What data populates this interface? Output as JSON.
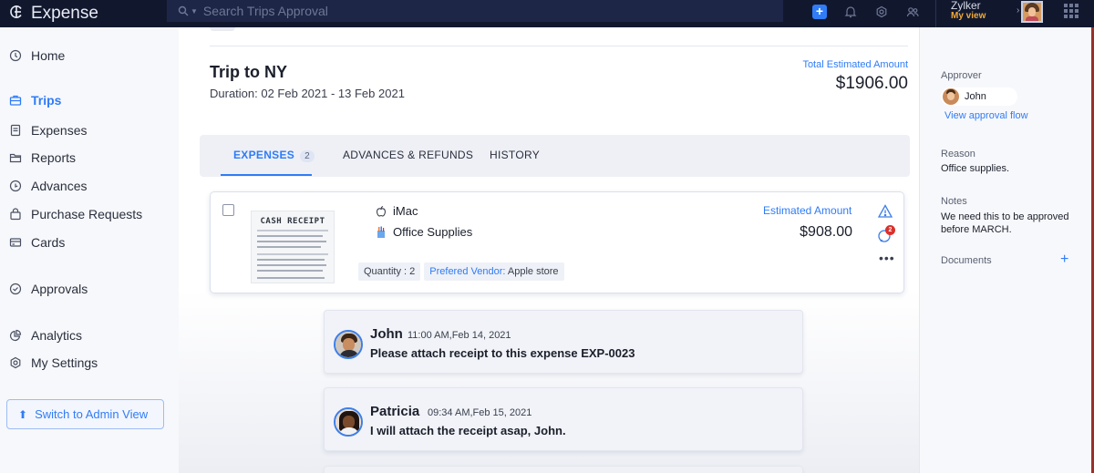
{
  "app": {
    "name": "Expense"
  },
  "search": {
    "placeholder": "Search Trips Approval"
  },
  "org": {
    "name": "Zylker",
    "view_label": "My view"
  },
  "sidebar": {
    "items": [
      {
        "label": "Home",
        "icon": "home-icon"
      },
      {
        "label": "Trips",
        "icon": "briefcase-icon",
        "active": true
      },
      {
        "label": "Expenses",
        "icon": "receipt-icon"
      },
      {
        "label": "Reports",
        "icon": "folder-icon"
      },
      {
        "label": "Advances",
        "icon": "advance-icon"
      },
      {
        "label": "Purchase Requests",
        "icon": "bag-icon"
      },
      {
        "label": "Cards",
        "icon": "card-icon"
      },
      {
        "label": "Approvals",
        "icon": "check-circle-icon"
      },
      {
        "label": "Analytics",
        "icon": "pie-chart-icon"
      },
      {
        "label": "My Settings",
        "icon": "gear-icon"
      }
    ],
    "switch_label": "Switch to Admin View"
  },
  "trip": {
    "title": "Trip to NY",
    "duration": "Duration: 02 Feb 2021 - 13 Feb 2021",
    "total_label": "Total Estimated Amount",
    "total_value": "$1906.00"
  },
  "tabs": [
    {
      "label": "EXPENSES",
      "count": "2",
      "active": true
    },
    {
      "label": "ADVANCES & REFUNDS"
    },
    {
      "label": "HISTORY"
    }
  ],
  "expense": {
    "receipt_title": "CASH RECEIPT",
    "item_name": "iMac",
    "category": "Office Supplies",
    "quantity": "Quantity : 2",
    "vendor_key": "Prefered Vendor:",
    "vendor_value": "Apple store",
    "estimated_label": "Estimated Amount",
    "estimated_value": "$908.00",
    "comment_count": "2"
  },
  "comments": [
    {
      "name": "John",
      "time": "11:00 AM,Feb 14, 2021",
      "text": "Please attach receipt to this expense EXP-0023"
    },
    {
      "name": "Patricia",
      "time": "09:34 AM,Feb 15, 2021",
      "text": "I will attach the receipt asap, John."
    }
  ],
  "right_panel": {
    "approver_label": "Approver",
    "approver_name": "John",
    "approval_flow_link": "View approval flow",
    "reason_label": "Reason",
    "reason_value": "Office supplies.",
    "notes_label": "Notes",
    "notes_value": "We need this to be approved before MARCH.",
    "documents_label": "Documents"
  },
  "colors": {
    "accent": "#2f7cf6",
    "topbar": "#11182e",
    "badge": "#d9312c"
  }
}
